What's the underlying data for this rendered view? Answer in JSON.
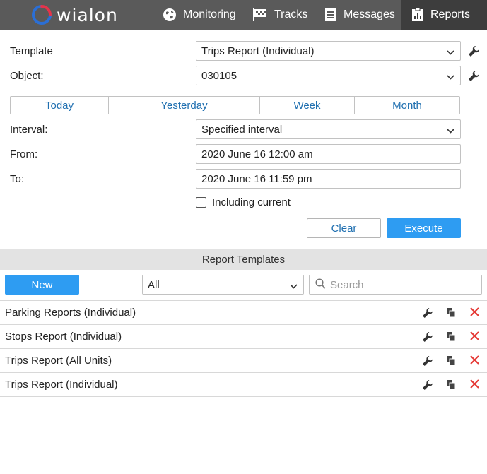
{
  "app": {
    "logo_text": "wialon"
  },
  "nav": {
    "monitoring": "Monitoring",
    "tracks": "Tracks",
    "messages": "Messages",
    "reports": "Reports"
  },
  "form": {
    "template_label": "Template",
    "template_value": "Trips Report (Individual)",
    "object_label": "Object:",
    "object_value": "030105",
    "periods": [
      "Today",
      "Yesterday",
      "Week",
      "Month"
    ],
    "interval_label": "Interval:",
    "interval_value": "Specified interval",
    "from_label": "From:",
    "from_value": "2020 June 16 12:00 am",
    "to_label": "To:",
    "to_value": "2020 June 16 11:59 pm",
    "including_current": "Including current",
    "clear": "Clear",
    "execute": "Execute"
  },
  "templates": {
    "header": "Report Templates",
    "new_button": "New",
    "filter_value": "All",
    "search_placeholder": "Search",
    "items": [
      "Parking Reports (Individual)",
      "Stops Report (Individual)",
      "Trips Report (All Units)",
      "Trips Report (Individual)"
    ]
  },
  "colors": {
    "topbar": "#5a5a5a",
    "active_tab": "#3d3d3d",
    "accent": "#2e9cf2",
    "link": "#1f6fb0",
    "delete": "#e53935"
  }
}
